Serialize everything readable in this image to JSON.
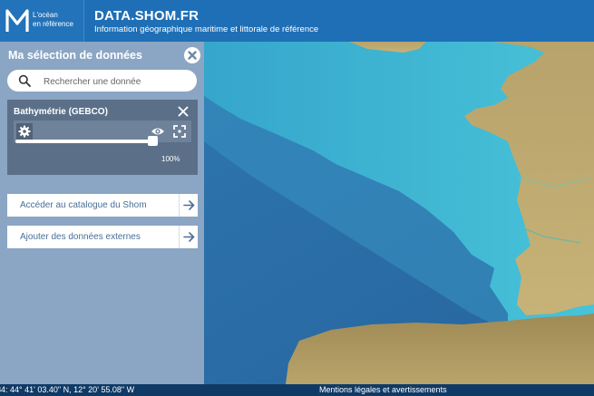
{
  "header": {
    "logo_line1": "L'océan",
    "logo_line2": "en référence",
    "title": "DATA.SHOM.FR",
    "subtitle": "Information géographique maritime et littorale de référence"
  },
  "panel": {
    "title": "Ma sélection de données",
    "search_placeholder": "Rechercher une donnée",
    "layer": {
      "name": "Bathymétrie (GEBCO)",
      "opacity_label": "100%",
      "opacity": 1.0
    },
    "buttons": [
      {
        "label": "Accéder au catalogue du Shom"
      },
      {
        "label": "Ajouter des données externes"
      }
    ]
  },
  "footer": {
    "coordinates": "84: 44° 41' 03.40\" N, 12° 20' 55.08\" W",
    "legal": "Mentions légales et avertissements"
  },
  "colors": {
    "header_bg": "#1f6fb6",
    "panel_bg": "#8aa6c4",
    "layer_card_bg": "#5b7088",
    "footer_bg": "#103a66",
    "deep_ocean": "#2c73ad",
    "shelf": "#3fb7d3",
    "land": "#bca86e"
  },
  "icons": {
    "close_panel": "circle-x-icon",
    "search": "magnifier-icon",
    "close_layer": "x-icon",
    "settings": "gear-icon",
    "visibility": "eye-icon",
    "zoom_extent": "expand-icon",
    "arrow": "arrow-right-icon"
  }
}
